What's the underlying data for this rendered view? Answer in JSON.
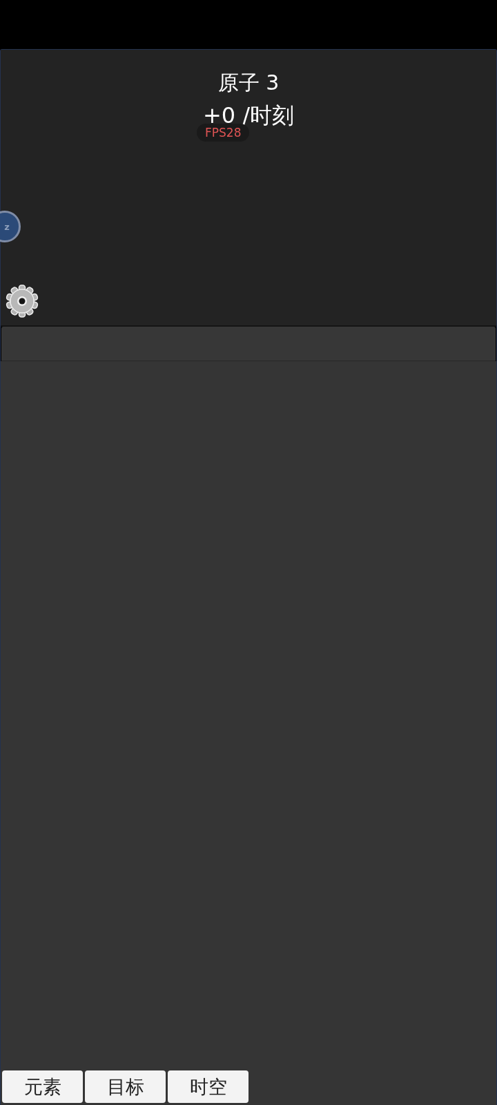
{
  "header": {
    "title": "原子 3",
    "rate": "+0 /时刻",
    "fps": "FPS28"
  },
  "sleep_button": {
    "label": "z"
  },
  "tabs": [
    {
      "label": "元素"
    },
    {
      "label": "目标"
    },
    {
      "label": "时空"
    }
  ]
}
